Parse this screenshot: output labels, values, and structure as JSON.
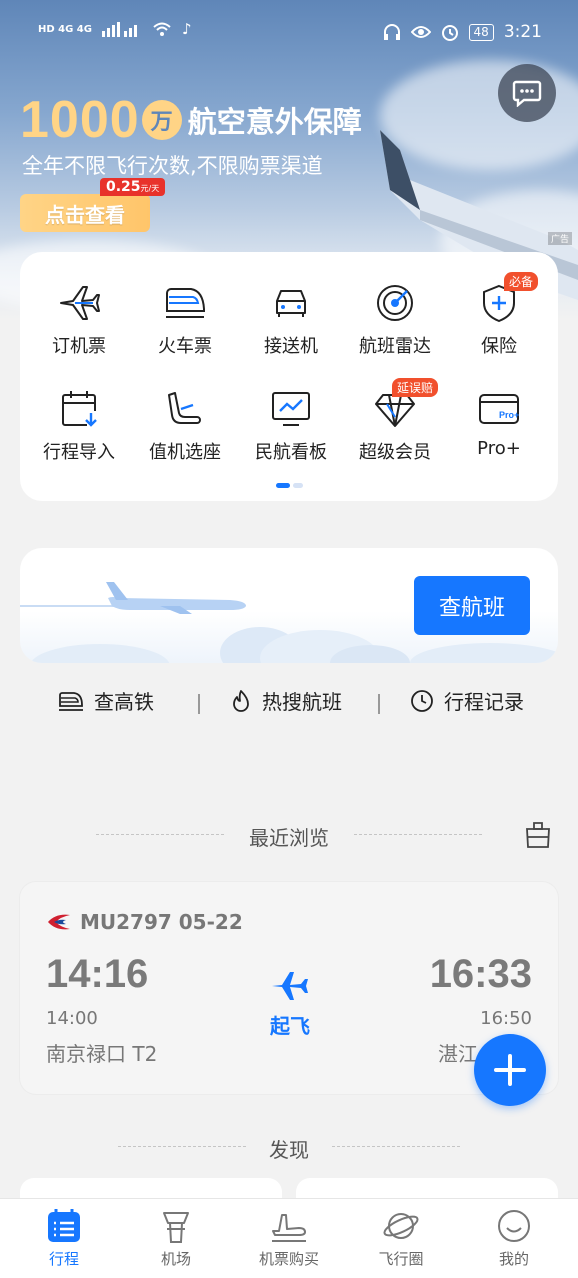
{
  "status_bar": {
    "network_left": "HD 4G 4G",
    "battery": "48",
    "time": "3:21"
  },
  "promo": {
    "amount": "1000",
    "unit": "万",
    "title": "航空意外保障",
    "subtitle": "全年不限飞行次数,不限购票渠道",
    "button": "点击查看",
    "price": "0.25",
    "price_unit": "元/天",
    "ad_label": "广告"
  },
  "services": [
    {
      "label": "订机票",
      "icon": "plane-icon"
    },
    {
      "label": "火车票",
      "icon": "train-icon"
    },
    {
      "label": "接送机",
      "icon": "car-icon"
    },
    {
      "label": "航班雷达",
      "icon": "radar-icon"
    },
    {
      "label": "保险",
      "icon": "shield-icon",
      "badge": "必备"
    },
    {
      "label": "行程导入",
      "icon": "calendar-import-icon"
    },
    {
      "label": "值机选座",
      "icon": "seat-icon"
    },
    {
      "label": "民航看板",
      "icon": "monitor-icon"
    },
    {
      "label": "超级会员",
      "icon": "diamond-icon",
      "badge": "延误赔"
    },
    {
      "label": "Pro+",
      "icon": "pro-card-icon"
    }
  ],
  "search": {
    "button": "查航班"
  },
  "quick_links": [
    {
      "label": "查高铁",
      "icon": "train-outline-icon"
    },
    {
      "label": "热搜航班",
      "icon": "flame-icon"
    },
    {
      "label": "行程记录",
      "icon": "clock-icon"
    }
  ],
  "recent": {
    "title": "最近浏览",
    "flight": {
      "number_date": "MU2797 05-22",
      "dep_time": "14:16",
      "dep_sched": "14:00",
      "dep_airport": "南京禄口 T2",
      "arr_time": "16:33",
      "arr_sched": "16:50",
      "arr_airport": "湛江",
      "status": "起飞"
    }
  },
  "discover": {
    "title": "发现"
  },
  "bottom_nav": [
    {
      "label": "行程",
      "icon": "itinerary-icon",
      "active": true
    },
    {
      "label": "机场",
      "icon": "tower-icon"
    },
    {
      "label": "机票购买",
      "icon": "plane-ticket-icon"
    },
    {
      "label": "飞行圈",
      "icon": "planet-icon"
    },
    {
      "label": "我的",
      "icon": "face-icon"
    }
  ],
  "colors": {
    "accent": "#1677ff",
    "promo_gold": "#ffd486",
    "badge_red": "#f1502d"
  }
}
